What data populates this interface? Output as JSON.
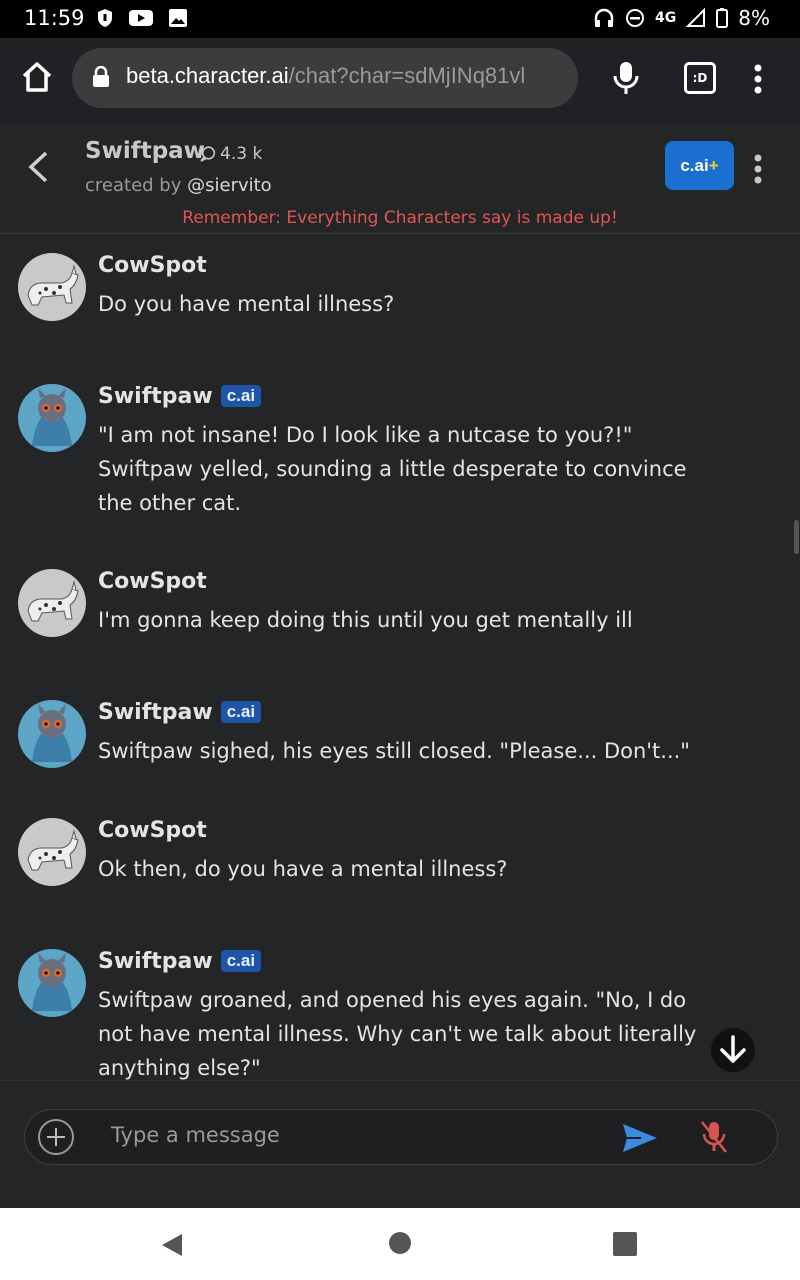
{
  "status_bar": {
    "time": "11:59",
    "network": "4G",
    "battery": "8%"
  },
  "browser": {
    "url_domain": "beta.character.ai",
    "url_path": "/chat?char=sdMjINq81vl",
    "tab_label": ":D"
  },
  "header": {
    "title": "Swiftpaw",
    "chat_count": "4.3 k",
    "created_prefix": "created by",
    "creator": "@siervito",
    "plus_label": "c.ai",
    "plus_sign": "+",
    "disclaimer": "Remember: Everything Characters say is made up!"
  },
  "messages": [
    {
      "author": "CowSpot",
      "badge": "",
      "text": "Do you have mental illness?"
    },
    {
      "author": "Swiftpaw",
      "badge": "c.ai",
      "text": "\"I am not insane! Do I look like a nutcase to you?!\" Swiftpaw yelled, sounding a little desperate to convince the other cat."
    },
    {
      "author": "CowSpot",
      "badge": "",
      "text": "I'm gonna keep doing this until you get mentally ill"
    },
    {
      "author": "Swiftpaw",
      "badge": "c.ai",
      "text": "Swiftpaw sighed, his eyes still closed. \"Please... Don't...\""
    },
    {
      "author": "CowSpot",
      "badge": "",
      "text": "Ok then, do you have a mental illness?"
    },
    {
      "author": "Swiftpaw",
      "badge": "c.ai",
      "text": "Swiftpaw groaned, and opened his eyes again. \"No, I do not have mental illness. Why can't we talk about literally anything else?\""
    }
  ],
  "composer": {
    "placeholder": "Type a message"
  },
  "colors": {
    "accent": "#1a6fd1",
    "badge": "#1f55a8",
    "warning": "#e05555",
    "send": "#3b8be0",
    "mic_off": "#d9534f"
  }
}
